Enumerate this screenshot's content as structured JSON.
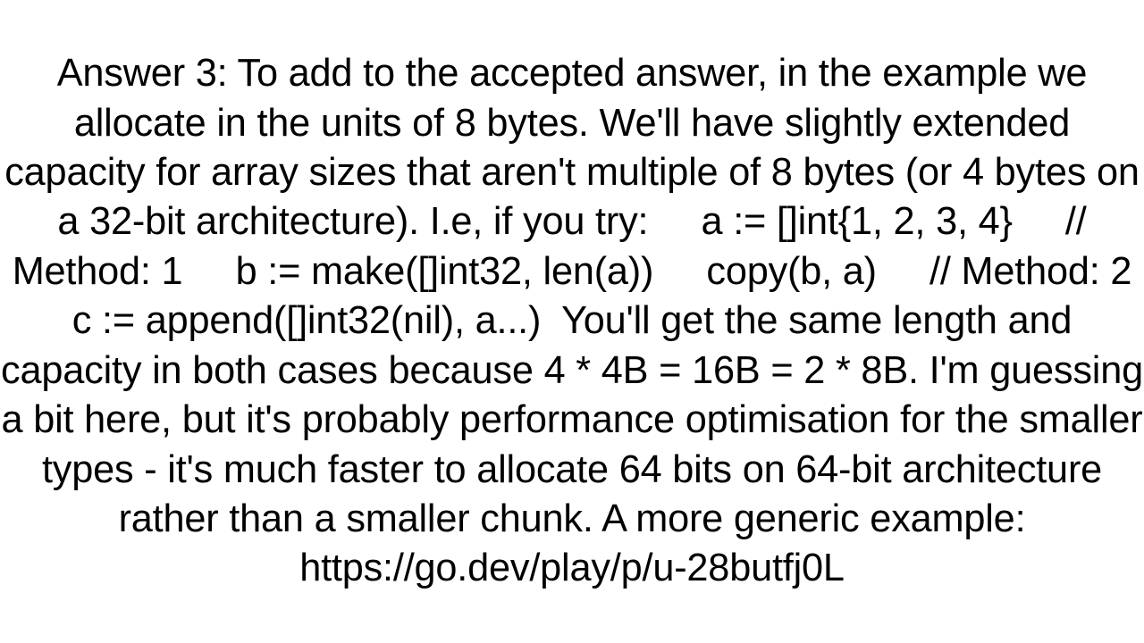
{
  "answer": {
    "text": "Answer 3: To add to the accepted answer, in the example we allocate in the units of 8 bytes. We'll have slightly extended capacity for array sizes that aren't multiple of 8 bytes (or 4 bytes on a 32-bit architecture). I.e, if you try:     a := []int{1, 2, 3, 4}     // Method: 1     b := make([]int32, len(a))     copy(b, a)     // Method: 2     c := append([]int32(nil), a...)  You'll get the same length and capacity in both cases because 4 * 4B = 16B = 2 * 8B. I'm guessing a bit here, but it's probably performance optimisation for the smaller types - it's much faster to allocate 64 bits on 64-bit architecture rather than a smaller chunk. A more generic example: https://go.dev/play/p/u-28butfj0L"
  }
}
